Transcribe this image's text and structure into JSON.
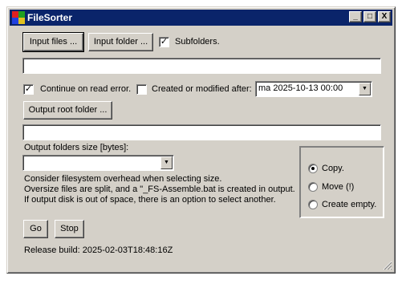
{
  "window": {
    "title": "FileSorter",
    "controls": {
      "minimize": "_",
      "maximize": "□",
      "close": "X"
    }
  },
  "input": {
    "files_button": "Input files ...",
    "folder_button": "Input folder ...",
    "subfolders_label": "Subfolders.",
    "subfolders_checked": true,
    "path_value": ""
  },
  "options": {
    "continue_on_error_label": "Continue on read error.",
    "continue_on_error_checked": true,
    "modified_after_label": "Created or modified after:",
    "modified_after_checked": false,
    "date_value": "ma 2025-10-13 00:00"
  },
  "output": {
    "root_button": "Output root folder ...",
    "path_value": "",
    "size_label": "Output folders size [bytes]:",
    "size_value": "",
    "notes": [
      "Consider filesystem overhead when selecting size.",
      "Oversize files are split, and a \"_FS-Assemble.bat is created in output.",
      "If output disk is out of space, there is an option to select another."
    ]
  },
  "mode": {
    "options": [
      "Copy.",
      "Move (!)",
      "Create empty."
    ],
    "selected": "Copy."
  },
  "actions": {
    "go": "Go",
    "stop": "Stop"
  },
  "status": {
    "release_build": "Release build: 2025-02-03T18:48:16Z"
  },
  "colors": {
    "titlebar": "#0a246a",
    "face": "#d4d0c8"
  }
}
